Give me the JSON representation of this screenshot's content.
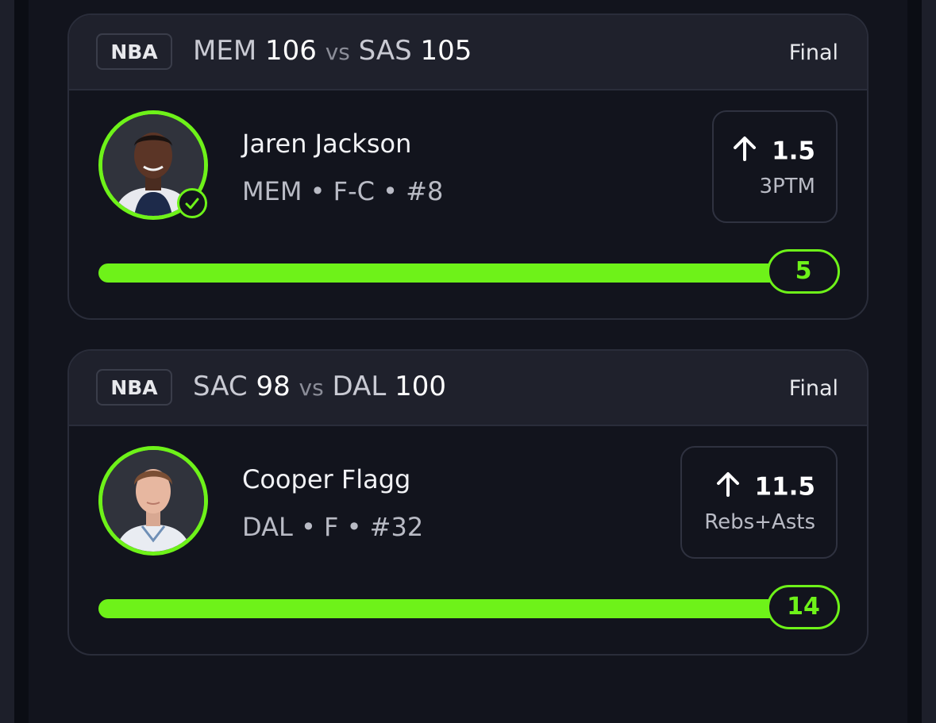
{
  "colors": {
    "accent": "#6ef219",
    "card_bg": "#12141d",
    "header_bg": "#1f212c",
    "border": "#2a2d3a"
  },
  "cards": [
    {
      "league": "NBA",
      "home_team": "MEM",
      "home_score": "106",
      "vs": "vs",
      "away_team": "SAS",
      "away_score": "105",
      "status": "Final",
      "player": {
        "name": "Jaren Jackson",
        "meta": "MEM • F-C • #8",
        "avatar": "player-photo-jaren-jackson",
        "verified": true
      },
      "prop": {
        "direction_icon": "arrow-up-icon",
        "line": "1.5",
        "stat": "3PTM"
      },
      "progress": {
        "value": "5",
        "fill_percent": 100
      }
    },
    {
      "league": "NBA",
      "home_team": "SAC",
      "home_score": "98",
      "vs": "vs",
      "away_team": "DAL",
      "away_score": "100",
      "status": "Final",
      "player": {
        "name": "Cooper Flagg",
        "meta": "DAL • F • #32",
        "avatar": "player-photo-cooper-flagg",
        "verified": false
      },
      "prop": {
        "direction_icon": "arrow-up-icon",
        "line": "11.5",
        "stat": "Rebs+Asts"
      },
      "progress": {
        "value": "14",
        "fill_percent": 100
      }
    }
  ]
}
